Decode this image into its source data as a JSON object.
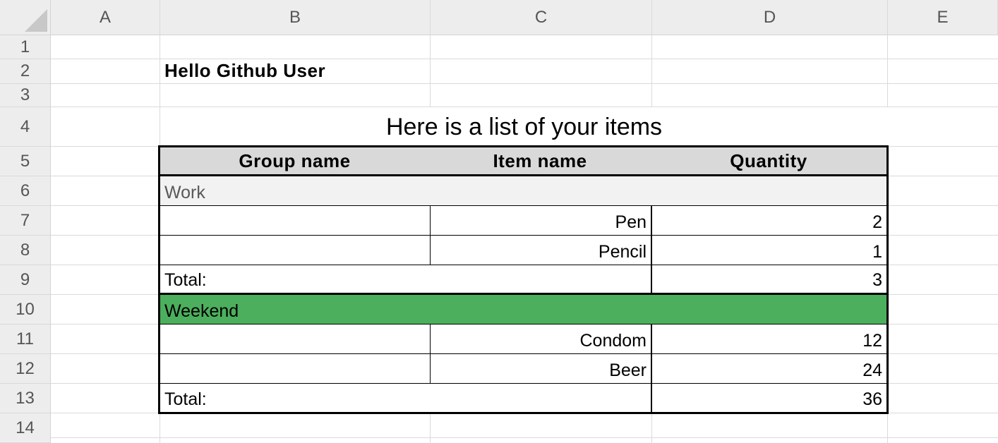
{
  "columns": [
    "A",
    "B",
    "C",
    "D",
    "E"
  ],
  "rows": [
    "1",
    "2",
    "3",
    "4",
    "5",
    "6",
    "7",
    "8",
    "9",
    "10",
    "11",
    "12",
    "13",
    "14"
  ],
  "greeting": "Hello Github User",
  "list_title": "Here is a list of your items",
  "table": {
    "headers": {
      "group": "Group name",
      "item": "Item name",
      "quantity": "Quantity"
    },
    "groups": [
      {
        "name": "Work",
        "items": [
          {
            "name": "Pen",
            "quantity": "2"
          },
          {
            "name": "Pencil",
            "quantity": "1"
          }
        ],
        "total_label": "Total:",
        "total": "3"
      },
      {
        "name": "Weekend",
        "items": [
          {
            "name": "Condom",
            "quantity": "12"
          },
          {
            "name": "Beer",
            "quantity": "24"
          }
        ],
        "total_label": "Total:",
        "total": "36"
      }
    ]
  },
  "colors": {
    "header_fill": "#d9d9d9",
    "work_fill": "#f2f2f2",
    "weekend_fill": "#4caf5d"
  }
}
